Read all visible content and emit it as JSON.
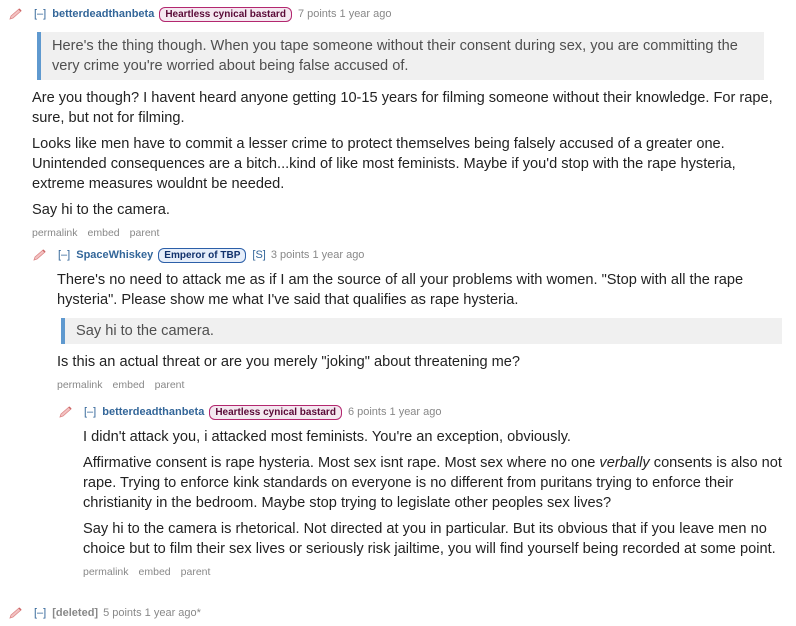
{
  "comments": [
    {
      "toggle": "[–]",
      "author": "betterdeadthanbeta",
      "flair": "Heartless cynical bastard",
      "score": "7 points 1 year ago",
      "quote": "Here's the thing though. When you tape someone without their consent during sex, you are committing the very crime you're worried about being false accused of.",
      "paragraphs": [
        "Are you though? I havent heard anyone getting 10-15 years for filming someone without their knowledge. For rape, sure, but not for filming.",
        "Looks like men have to commit a lesser crime to protect themselves being falsely accused of a greater one. Unintended consequences are a bitch...kind of like most feminists. Maybe if you'd stop with the rape hysteria, extreme measures wouldnt be needed.",
        "Say hi to the camera."
      ],
      "buttons": [
        "permalink",
        "embed",
        "parent"
      ]
    },
    {
      "toggle": "[–]",
      "author": "SpaceWhiskey",
      "flair": "Emperor of TBP",
      "submitter": "[S]",
      "score": "3 points 1 year ago",
      "paragraph_1": "There's no need to attack me as if I am the source of all your problems with women. \"Stop with all the rape hysteria\". Please show me what I've said that qualifies as rape hysteria.",
      "quote": "Say hi to the camera.",
      "paragraph_2": "Is this an actual threat or are you merely \"joking\" about threatening me?",
      "buttons": [
        "permalink",
        "embed",
        "parent"
      ]
    },
    {
      "toggle": "[–]",
      "author": "betterdeadthanbeta",
      "flair": "Heartless cynical bastard",
      "score": "6 points 1 year ago",
      "paragraph_1": "I didn't attack you, i attacked most feminists. You're an exception, obviously.",
      "paragraph_2_pre": "Affirmative consent is rape hysteria. Most sex isnt rape. Most sex where no one ",
      "paragraph_2_em": "verbally",
      "paragraph_2_post": " consents is also not rape. Trying to enforce kink standards on everyone is no different from puritans trying to enforce their christianity in the bedroom. Maybe stop trying to legislate other peoples sex lives?",
      "paragraph_3": "Say hi to the camera is rhetorical. Not directed at you in particular. But its obvious that if you leave men no choice but to film their sex lives or seriously risk jailtime, you will find yourself being recorded at some point.",
      "buttons": [
        "permalink",
        "embed",
        "parent"
      ]
    },
    {
      "toggle": "[–]",
      "author": "[deleted]",
      "score": "5 points 1 year ago*"
    }
  ],
  "colors": {
    "link": "#336699",
    "quote_bar": "#5f99cf",
    "flair_pink": "#b3276f",
    "flair_blue": "#2c5fa8"
  },
  "icons": {
    "pen": "pencil-icon"
  }
}
